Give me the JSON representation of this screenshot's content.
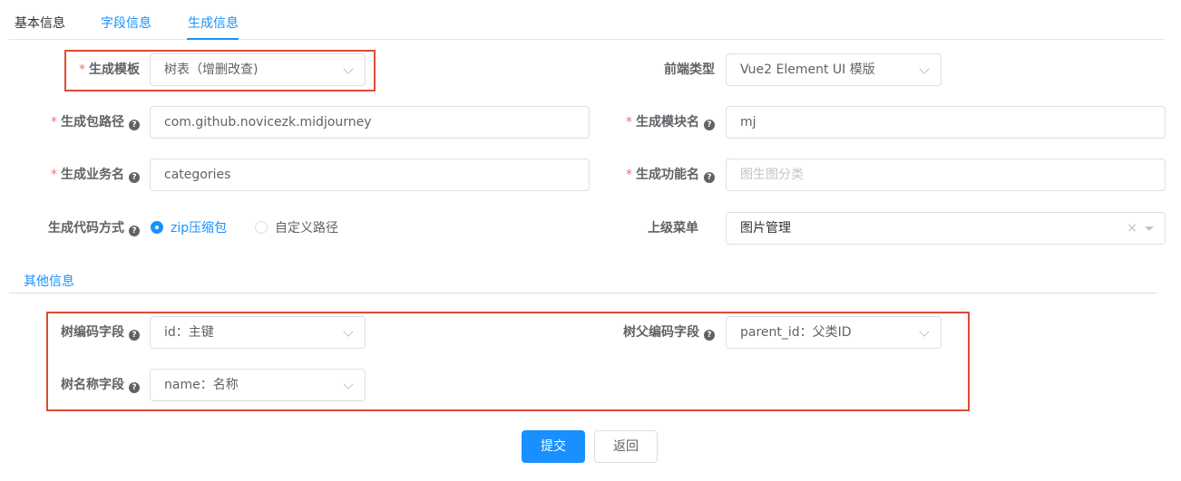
{
  "tabs": [
    {
      "label": "基本信息",
      "state": "plain"
    },
    {
      "label": "字段信息",
      "state": "link"
    },
    {
      "label": "生成信息",
      "state": "active"
    }
  ],
  "gen": {
    "template": {
      "label": "生成模板",
      "value": "树表（增删改查)"
    },
    "frontend_type": {
      "label": "前端类型",
      "value": "Vue2 Element UI 模版"
    },
    "package_path": {
      "label": "生成包路径",
      "value": "com.github.novicezk.midjourney"
    },
    "module_name": {
      "label": "生成模块名",
      "value": "mj"
    },
    "business_name": {
      "label": "生成业务名",
      "value": "categories"
    },
    "function_name": {
      "label": "生成功能名",
      "placeholder": "图生图分类"
    },
    "code_method": {
      "label": "生成代码方式",
      "options": [
        "zip压缩包",
        "自定义路径"
      ],
      "selected": "zip压缩包"
    },
    "parent_menu": {
      "label": "上级菜单",
      "value": "图片管理",
      "clear_icon": "clear-icon"
    }
  },
  "other": {
    "title": "其他信息",
    "tree_code": {
      "label": "树编码字段",
      "value": "id：主键"
    },
    "tree_parent_code": {
      "label": "树父编码字段",
      "value": "parent_id：父类ID"
    },
    "tree_name": {
      "label": "树名称字段",
      "value": "name：名称"
    }
  },
  "actions": {
    "submit": "提交",
    "back": "返回"
  },
  "colors": {
    "primary": "#1890ff",
    "required": "#f56c6c",
    "highlight": "#e04b33"
  },
  "icons": {
    "help": "question-circle-icon",
    "dropdown": "chevron-down-icon",
    "clear": "clear-icon"
  }
}
